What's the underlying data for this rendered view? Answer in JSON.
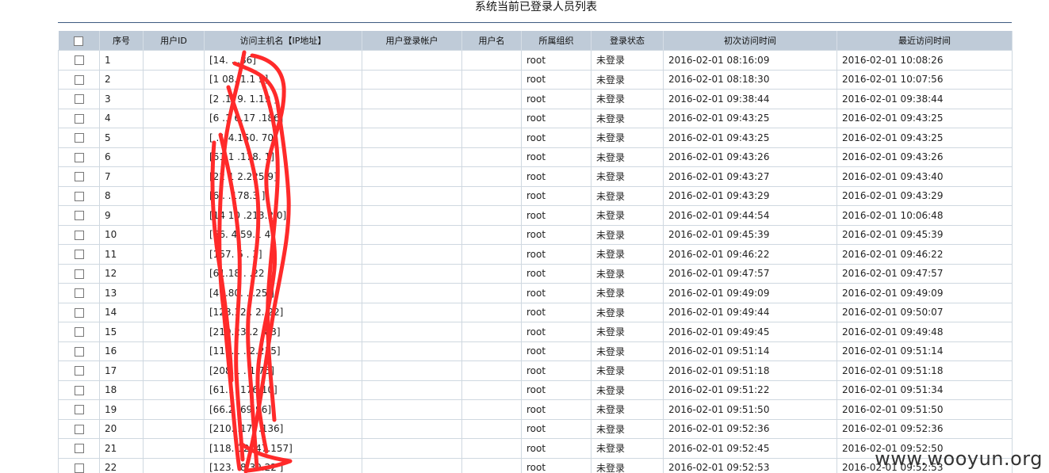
{
  "page": {
    "title": "系统当前已登录人员列表"
  },
  "table": {
    "headers": [
      "",
      "序号",
      "用户ID",
      "访问主机名【IP地址】",
      "用户登录帐户",
      "用户名",
      "所属组织",
      "登录状态",
      "初次访问时间",
      "最近访问时间"
    ],
    "rows": [
      {
        "no": "1",
        "uid": "",
        "host": "[14.    .    .86]",
        "account": "",
        "name": "",
        "org": "root",
        "status": "未登录",
        "first": "2016-02-01 08:16:09",
        "last": "2016-02-01 10:08:26"
      },
      {
        "no": "2",
        "uid": "",
        "host": "[1    08.  1.1  5]",
        "account": "",
        "name": "",
        "org": "root",
        "status": "未登录",
        "first": "2016-02-01 08:18:30",
        "last": "2016-02-01 10:07:56"
      },
      {
        "no": "3",
        "uid": "",
        "host": "[2  .179.  1.19 ]",
        "account": "",
        "name": "",
        "org": "root",
        "status": "未登录",
        "first": "2016-02-01 09:38:44",
        "last": "2016-02-01 09:38:44"
      },
      {
        "no": "4",
        "uid": "",
        "host": "[6  .1  6.17  .186]",
        "account": "",
        "name": "",
        "org": "root",
        "status": "未登录",
        "first": "2016-02-01 09:43:25",
        "last": "2016-02-01 09:43:25"
      },
      {
        "no": "5",
        "uid": "",
        "host": "[  .1  4.150.  70]",
        "account": "",
        "name": "",
        "org": "root",
        "status": "未登录",
        "first": "2016-02-01 09:43:25",
        "last": "2016-02-01 09:43:25"
      },
      {
        "no": "6",
        "uid": "",
        "host": "[61.1  .178.  1]",
        "account": "",
        "name": "",
        "org": "root",
        "status": "未登录",
        "first": "2016-02-01 09:43:26",
        "last": "2016-02-01 09:43:26"
      },
      {
        "no": "7",
        "uid": "",
        "host": "[22  1  2.225  9]",
        "account": "",
        "name": "",
        "org": "root",
        "status": "未登录",
        "first": "2016-02-01 09:43:27",
        "last": "2016-02-01 09:43:40"
      },
      {
        "no": "8",
        "uid": "",
        "host": "[6  .   .178.3  ]",
        "account": "",
        "name": "",
        "org": "root",
        "status": "未登录",
        "first": "2016-02-01 09:43:29",
        "last": "2016-02-01 09:43:29"
      },
      {
        "no": "9",
        "uid": "",
        "host": "[14  10  .213.2  0]",
        "account": "",
        "name": "",
        "org": "root",
        "status": "未登录",
        "first": "2016-02-01 09:44:54",
        "last": "2016-02-01 10:06:48"
      },
      {
        "no": "10",
        "uid": "",
        "host": "[66.  4  59.1  4]",
        "account": "",
        "name": "",
        "org": "root",
        "status": "未登录",
        "first": "2016-02-01 09:45:39",
        "last": "2016-02-01 09:45:39"
      },
      {
        "no": "11",
        "uid": "",
        "host": "[157.  5  .  3]",
        "account": "",
        "name": "",
        "org": "root",
        "status": "未登录",
        "first": "2016-02-01 09:46:22",
        "last": "2016-02-01 09:46:22"
      },
      {
        "no": "12",
        "uid": "",
        "host": "[61.18  .  .22  ]",
        "account": "",
        "name": "",
        "org": "root",
        "status": "未登录",
        "first": "2016-02-01 09:47:57",
        "last": "2016-02-01 09:47:57"
      },
      {
        "no": "13",
        "uid": "",
        "host": "[49.80.  .  .25  ]",
        "account": "",
        "name": "",
        "org": "root",
        "status": "未登录",
        "first": "2016-02-01 09:49:09",
        "last": "2016-02-01 09:49:09"
      },
      {
        "no": "14",
        "uid": "",
        "host": "[123.12  .  2.  22]",
        "account": "",
        "name": "",
        "org": "root",
        "status": "未登录",
        "first": "2016-02-01 09:49:44",
        "last": "2016-02-01 09:50:07"
      },
      {
        "no": "15",
        "uid": "",
        "host": "[219.23  .2  .83]",
        "account": "",
        "name": "",
        "org": "root",
        "status": "未登录",
        "first": "2016-02-01 09:49:45",
        "last": "2016-02-01 09:49:48"
      },
      {
        "no": "16",
        "uid": "",
        "host": "[119.1  .  2.215]",
        "account": "",
        "name": "",
        "org": "root",
        "status": "未登录",
        "first": "2016-02-01 09:51:14",
        "last": "2016-02-01 09:51:14"
      },
      {
        "no": "17",
        "uid": "",
        "host": "[208.1  .  1.75]",
        "account": "",
        "name": "",
        "org": "root",
        "status": "未登录",
        "first": "2016-02-01 09:51:18",
        "last": "2016-02-01 09:51:18"
      },
      {
        "no": "18",
        "uid": "",
        "host": "[61.1  .176.10]",
        "account": "",
        "name": "",
        "org": "root",
        "status": "未登录",
        "first": "2016-02-01 09:51:22",
        "last": "2016-02-01 09:51:34"
      },
      {
        "no": "19",
        "uid": "",
        "host": "[66.2  .69.96]",
        "account": "",
        "name": "",
        "org": "root",
        "status": "未登录",
        "first": "2016-02-01 09:51:50",
        "last": "2016-02-01 09:51:50"
      },
      {
        "no": "20",
        "uid": "",
        "host": "[210.  .177.136]",
        "account": "",
        "name": "",
        "org": "root",
        "status": "未登录",
        "first": "2016-02-01 09:52:36",
        "last": "2016-02-01 09:52:36"
      },
      {
        "no": "21",
        "uid": "",
        "host": "[118.  12.  47.157]",
        "account": "",
        "name": "",
        "org": "root",
        "status": "未登录",
        "first": "2016-02-01 09:52:45",
        "last": "2016-02-01 09:52:50"
      },
      {
        "no": "22",
        "uid": "",
        "host": "[123.  .8.39.22  ]",
        "account": "",
        "name": "",
        "org": "root",
        "status": "未登录",
        "first": "2016-02-01 09:52:53",
        "last": "2016-02-01 09:52:53"
      }
    ]
  },
  "watermark": "www.wooyun.org",
  "colors": {
    "header_bg": "#bfcbd8",
    "title_rule": "#3d5a80",
    "scribble": "#ff2a2a"
  }
}
